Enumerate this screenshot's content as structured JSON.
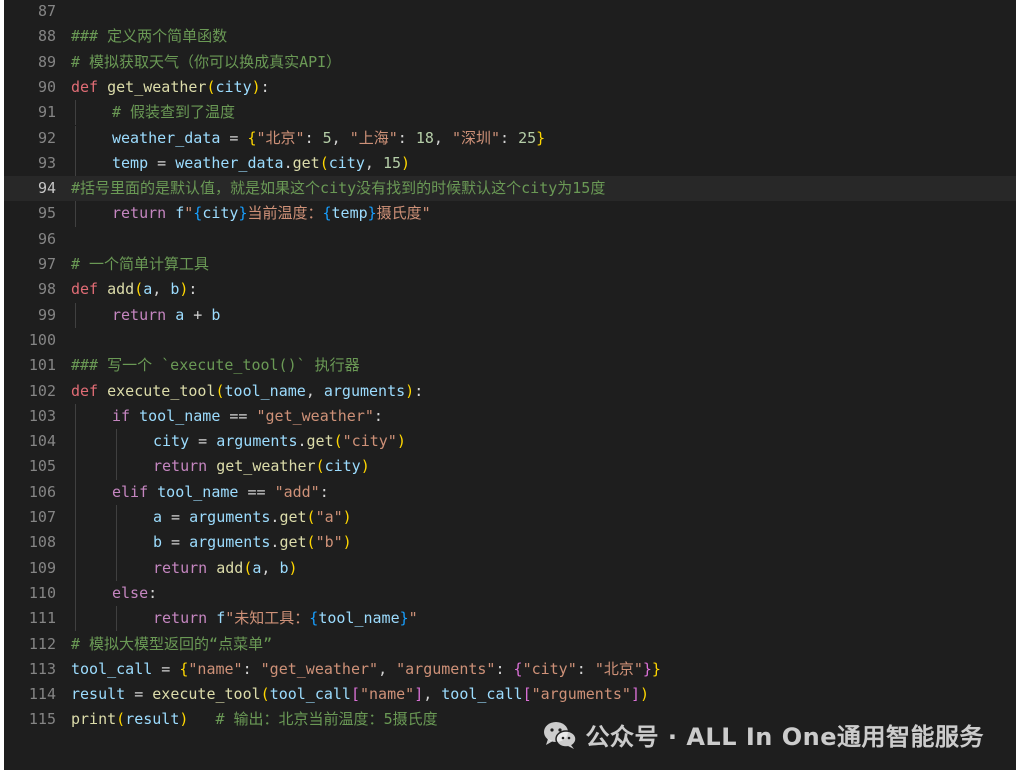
{
  "editor": {
    "language": "python",
    "current_line": 94,
    "lines": [
      {
        "num": "87",
        "tokens": []
      },
      {
        "num": "88",
        "tokens": [
          {
            "t": "### 定义两个简单函数",
            "c": "cm"
          }
        ]
      },
      {
        "num": "89",
        "tokens": [
          {
            "t": "# 模拟获取天气（你可以换成真实API）",
            "c": "cm"
          }
        ]
      },
      {
        "num": "90",
        "tokens": [
          {
            "t": "def",
            "c": "def"
          },
          {
            "t": " ",
            "c": "plain"
          },
          {
            "t": "get_weather",
            "c": "fn"
          },
          {
            "t": "(",
            "c": "br1"
          },
          {
            "t": "city",
            "c": "var"
          },
          {
            "t": ")",
            "c": "br1"
          },
          {
            "t": ":",
            "c": "plain"
          }
        ]
      },
      {
        "num": "91",
        "indent": 1,
        "tokens": [
          {
            "t": "# 假装查到了温度",
            "c": "cm"
          }
        ]
      },
      {
        "num": "92",
        "indent": 1,
        "tokens": [
          {
            "t": "weather_data",
            "c": "var"
          },
          {
            "t": " = ",
            "c": "plain"
          },
          {
            "t": "{",
            "c": "br1"
          },
          {
            "t": "\"北京\"",
            "c": "str"
          },
          {
            "t": ": ",
            "c": "plain"
          },
          {
            "t": "5",
            "c": "num"
          },
          {
            "t": ", ",
            "c": "plain"
          },
          {
            "t": "\"上海\"",
            "c": "str"
          },
          {
            "t": ": ",
            "c": "plain"
          },
          {
            "t": "18",
            "c": "num"
          },
          {
            "t": ", ",
            "c": "plain"
          },
          {
            "t": "\"深圳\"",
            "c": "str"
          },
          {
            "t": ": ",
            "c": "plain"
          },
          {
            "t": "25",
            "c": "num"
          },
          {
            "t": "}",
            "c": "br1"
          }
        ]
      },
      {
        "num": "93",
        "indent": 1,
        "tokens": [
          {
            "t": "temp",
            "c": "var"
          },
          {
            "t": " = ",
            "c": "plain"
          },
          {
            "t": "weather_data",
            "c": "var"
          },
          {
            "t": ".",
            "c": "plain"
          },
          {
            "t": "get",
            "c": "fn"
          },
          {
            "t": "(",
            "c": "br1"
          },
          {
            "t": "city",
            "c": "var"
          },
          {
            "t": ", ",
            "c": "plain"
          },
          {
            "t": "15",
            "c": "num"
          },
          {
            "t": ")",
            "c": "br1"
          }
        ]
      },
      {
        "num": "94",
        "tokens": [
          {
            "t": "#括号里面的是默认值，就是如果这个city没有找到的时候默认这个city为15度",
            "c": "cm"
          }
        ]
      },
      {
        "num": "95",
        "indent": 1,
        "tokens": [
          {
            "t": "return",
            "c": "kw"
          },
          {
            "t": " ",
            "c": "plain"
          },
          {
            "t": "f",
            "c": "var"
          },
          {
            "t": "\"",
            "c": "str"
          },
          {
            "t": "{",
            "c": "br3"
          },
          {
            "t": "city",
            "c": "var"
          },
          {
            "t": "}",
            "c": "br3"
          },
          {
            "t": "当前温度：",
            "c": "str"
          },
          {
            "t": "{",
            "c": "br3"
          },
          {
            "t": "temp",
            "c": "var"
          },
          {
            "t": "}",
            "c": "br3"
          },
          {
            "t": "摄氏度\"",
            "c": "str"
          }
        ]
      },
      {
        "num": "96",
        "tokens": []
      },
      {
        "num": "97",
        "tokens": [
          {
            "t": "# 一个简单计算工具",
            "c": "cm"
          }
        ]
      },
      {
        "num": "98",
        "tokens": [
          {
            "t": "def",
            "c": "def"
          },
          {
            "t": " ",
            "c": "plain"
          },
          {
            "t": "add",
            "c": "fn"
          },
          {
            "t": "(",
            "c": "br1"
          },
          {
            "t": "a",
            "c": "var"
          },
          {
            "t": ", ",
            "c": "plain"
          },
          {
            "t": "b",
            "c": "var"
          },
          {
            "t": ")",
            "c": "br1"
          },
          {
            "t": ":",
            "c": "plain"
          }
        ]
      },
      {
        "num": "99",
        "indent": 1,
        "tokens": [
          {
            "t": "return",
            "c": "kw"
          },
          {
            "t": " ",
            "c": "plain"
          },
          {
            "t": "a",
            "c": "var"
          },
          {
            "t": " + ",
            "c": "plain"
          },
          {
            "t": "b",
            "c": "var"
          }
        ]
      },
      {
        "num": "100",
        "tokens": []
      },
      {
        "num": "101",
        "tokens": [
          {
            "t": "### 写一个 `execute_tool()` 执行器",
            "c": "cm"
          }
        ]
      },
      {
        "num": "102",
        "tokens": [
          {
            "t": "def",
            "c": "def"
          },
          {
            "t": " ",
            "c": "plain"
          },
          {
            "t": "execute_tool",
            "c": "fn"
          },
          {
            "t": "(",
            "c": "br1"
          },
          {
            "t": "tool_name",
            "c": "var"
          },
          {
            "t": ", ",
            "c": "plain"
          },
          {
            "t": "arguments",
            "c": "var"
          },
          {
            "t": ")",
            "c": "br1"
          },
          {
            "t": ":",
            "c": "plain"
          }
        ]
      },
      {
        "num": "103",
        "indent": 1,
        "tokens": [
          {
            "t": "if",
            "c": "kw"
          },
          {
            "t": " ",
            "c": "plain"
          },
          {
            "t": "tool_name",
            "c": "var"
          },
          {
            "t": " == ",
            "c": "plain"
          },
          {
            "t": "\"get_weather\"",
            "c": "str"
          },
          {
            "t": ":",
            "c": "plain"
          }
        ]
      },
      {
        "num": "104",
        "indent": 2,
        "tokens": [
          {
            "t": "city",
            "c": "var"
          },
          {
            "t": " = ",
            "c": "plain"
          },
          {
            "t": "arguments",
            "c": "var"
          },
          {
            "t": ".",
            "c": "plain"
          },
          {
            "t": "get",
            "c": "fn"
          },
          {
            "t": "(",
            "c": "br1"
          },
          {
            "t": "\"city\"",
            "c": "str"
          },
          {
            "t": ")",
            "c": "br1"
          }
        ]
      },
      {
        "num": "105",
        "indent": 2,
        "tokens": [
          {
            "t": "return",
            "c": "kw"
          },
          {
            "t": " ",
            "c": "plain"
          },
          {
            "t": "get_weather",
            "c": "fn"
          },
          {
            "t": "(",
            "c": "br1"
          },
          {
            "t": "city",
            "c": "var"
          },
          {
            "t": ")",
            "c": "br1"
          }
        ]
      },
      {
        "num": "106",
        "indent": 1,
        "tokens": [
          {
            "t": "elif",
            "c": "kw"
          },
          {
            "t": " ",
            "c": "plain"
          },
          {
            "t": "tool_name",
            "c": "var"
          },
          {
            "t": " == ",
            "c": "plain"
          },
          {
            "t": "\"add\"",
            "c": "str"
          },
          {
            "t": ":",
            "c": "plain"
          }
        ]
      },
      {
        "num": "107",
        "indent": 2,
        "tokens": [
          {
            "t": "a",
            "c": "var"
          },
          {
            "t": " = ",
            "c": "plain"
          },
          {
            "t": "arguments",
            "c": "var"
          },
          {
            "t": ".",
            "c": "plain"
          },
          {
            "t": "get",
            "c": "fn"
          },
          {
            "t": "(",
            "c": "br1"
          },
          {
            "t": "\"a\"",
            "c": "str"
          },
          {
            "t": ")",
            "c": "br1"
          }
        ]
      },
      {
        "num": "108",
        "indent": 2,
        "tokens": [
          {
            "t": "b",
            "c": "var"
          },
          {
            "t": " = ",
            "c": "plain"
          },
          {
            "t": "arguments",
            "c": "var"
          },
          {
            "t": ".",
            "c": "plain"
          },
          {
            "t": "get",
            "c": "fn"
          },
          {
            "t": "(",
            "c": "br1"
          },
          {
            "t": "\"b\"",
            "c": "str"
          },
          {
            "t": ")",
            "c": "br1"
          }
        ]
      },
      {
        "num": "109",
        "indent": 2,
        "tokens": [
          {
            "t": "return",
            "c": "kw"
          },
          {
            "t": " ",
            "c": "plain"
          },
          {
            "t": "add",
            "c": "fn"
          },
          {
            "t": "(",
            "c": "br1"
          },
          {
            "t": "a",
            "c": "var"
          },
          {
            "t": ", ",
            "c": "plain"
          },
          {
            "t": "b",
            "c": "var"
          },
          {
            "t": ")",
            "c": "br1"
          }
        ]
      },
      {
        "num": "110",
        "indent": 1,
        "tokens": [
          {
            "t": "else",
            "c": "kw"
          },
          {
            "t": ":",
            "c": "plain"
          }
        ]
      },
      {
        "num": "111",
        "indent": 2,
        "tokens": [
          {
            "t": "return",
            "c": "kw"
          },
          {
            "t": " ",
            "c": "plain"
          },
          {
            "t": "f",
            "c": "var"
          },
          {
            "t": "\"未知工具：",
            "c": "str"
          },
          {
            "t": "{",
            "c": "br3"
          },
          {
            "t": "tool_name",
            "c": "var"
          },
          {
            "t": "}",
            "c": "br3"
          },
          {
            "t": "\"",
            "c": "str"
          }
        ]
      },
      {
        "num": "112",
        "tokens": [
          {
            "t": "# 模拟大模型返回的“点菜单”",
            "c": "cm"
          }
        ]
      },
      {
        "num": "113",
        "tokens": [
          {
            "t": "tool_call",
            "c": "var"
          },
          {
            "t": " = ",
            "c": "plain"
          },
          {
            "t": "{",
            "c": "br1"
          },
          {
            "t": "\"name\"",
            "c": "str"
          },
          {
            "t": ": ",
            "c": "plain"
          },
          {
            "t": "\"get_weather\"",
            "c": "str"
          },
          {
            "t": ", ",
            "c": "plain"
          },
          {
            "t": "\"arguments\"",
            "c": "str"
          },
          {
            "t": ": ",
            "c": "plain"
          },
          {
            "t": "{",
            "c": "br2"
          },
          {
            "t": "\"city\"",
            "c": "str"
          },
          {
            "t": ": ",
            "c": "plain"
          },
          {
            "t": "\"北京\"",
            "c": "str"
          },
          {
            "t": "}",
            "c": "br2"
          },
          {
            "t": "}",
            "c": "br1"
          }
        ]
      },
      {
        "num": "114",
        "tokens": [
          {
            "t": "result",
            "c": "var"
          },
          {
            "t": " = ",
            "c": "plain"
          },
          {
            "t": "execute_tool",
            "c": "fn"
          },
          {
            "t": "(",
            "c": "br1"
          },
          {
            "t": "tool_call",
            "c": "var"
          },
          {
            "t": "[",
            "c": "br2"
          },
          {
            "t": "\"name\"",
            "c": "str"
          },
          {
            "t": "]",
            "c": "br2"
          },
          {
            "t": ", ",
            "c": "plain"
          },
          {
            "t": "tool_call",
            "c": "var"
          },
          {
            "t": "[",
            "c": "br2"
          },
          {
            "t": "\"arguments\"",
            "c": "str"
          },
          {
            "t": "]",
            "c": "br2"
          },
          {
            "t": ")",
            "c": "br1"
          }
        ]
      },
      {
        "num": "115",
        "tokens": [
          {
            "t": "print",
            "c": "fn"
          },
          {
            "t": "(",
            "c": "br1"
          },
          {
            "t": "result",
            "c": "var"
          },
          {
            "t": ")",
            "c": "br1"
          },
          {
            "t": "   ",
            "c": "plain"
          },
          {
            "t": "# 输出：北京当前温度：5摄氏度",
            "c": "cm"
          }
        ]
      }
    ],
    "colors": {
      "background": "#1e1e1e",
      "current_line": "#282828",
      "keyword": "#c586c0",
      "def_keyword": "#e06c75",
      "function": "#dcdcaa",
      "variable": "#9cdcfe",
      "string": "#ce9178",
      "number": "#b5cea8",
      "comment": "#6a9955"
    }
  },
  "watermark": {
    "icon": "wechat-icon",
    "text": "公众号 · ALL In One通用智能服务"
  }
}
